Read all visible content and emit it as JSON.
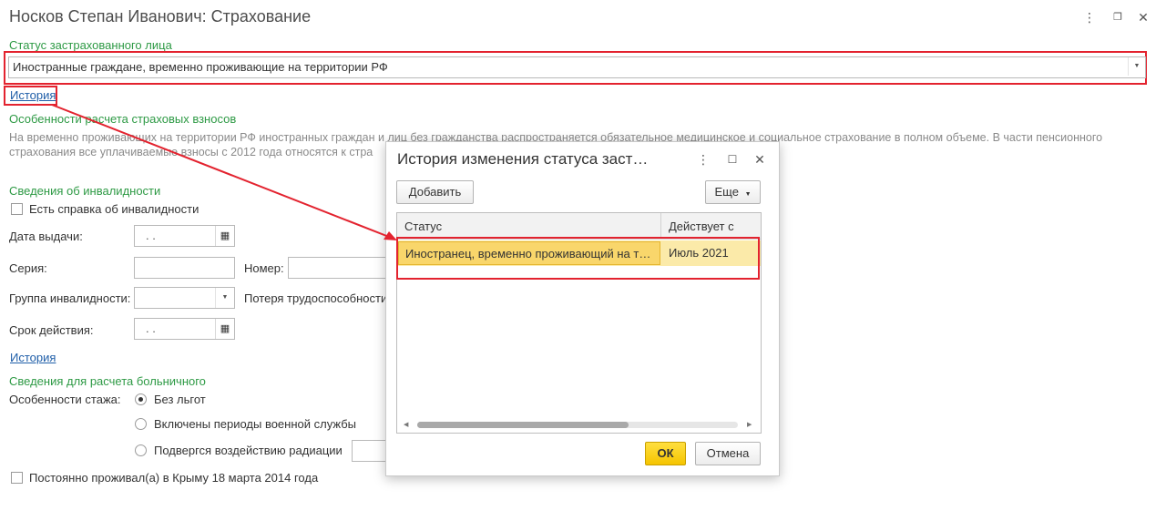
{
  "window": {
    "title": "Носков Степан Иванович: Страхование",
    "menu_icon": "more-vertical-icon",
    "maximize_icon": "restore-icon"
  },
  "insured_status": {
    "label": "Статус застрахованного лица",
    "value": "Иностранные граждане, временно проживающие на территории РФ",
    "history_link": "История"
  },
  "contributions": {
    "heading": "Особенности расчета страховых взносов",
    "text_line1": "На временно проживающих на территории РФ иностранных граждан и лиц без гражданства распространяется обязательное медицинское и социальное страхование в полном объеме. В части пенсионного",
    "text_line2": "страхования все уплачиваемые взносы с 2012 года относятся к стра"
  },
  "disability": {
    "heading": "Сведения об инвалидности",
    "certificate_checkbox": "Есть справка об инвалидности",
    "issue_date_label": "Дата выдачи:",
    "issue_date_value": " .  .",
    "series_label": "Серия:",
    "number_label": "Номер:",
    "group_label": "Группа инвалидности:",
    "work_loss_label": "Потеря трудоспособности",
    "validity_label": "Срок действия:",
    "validity_value": " .  .",
    "history_link": "История"
  },
  "sick_leave": {
    "heading": "Сведения для расчета больничного",
    "experience_label": "Особенности стажа:",
    "options": [
      "Без льгот",
      "Включены периоды военной службы",
      "Подвергся воздействию радиации"
    ],
    "selected_index": 0
  },
  "crimea_checkbox": "Постоянно проживал(а) в Крыму 18 марта 2014 года",
  "dialog": {
    "title": "История изменения статуса заст…",
    "add_button": "Добавить",
    "more_button": "Еще",
    "columns": [
      "Статус",
      "Действует с"
    ],
    "rows": [
      {
        "status": "Иностранец, временно проживающий на т…",
        "since": "Июль 2021"
      }
    ],
    "ok_button": "ОК",
    "cancel_button": "Отмена"
  },
  "colors": {
    "accent_green": "#2e9a45",
    "link_blue": "#1f5ea8",
    "highlight_red": "#e3232f",
    "ok_yellow": "#f5c400",
    "selected_row": "#fbeaa9"
  }
}
